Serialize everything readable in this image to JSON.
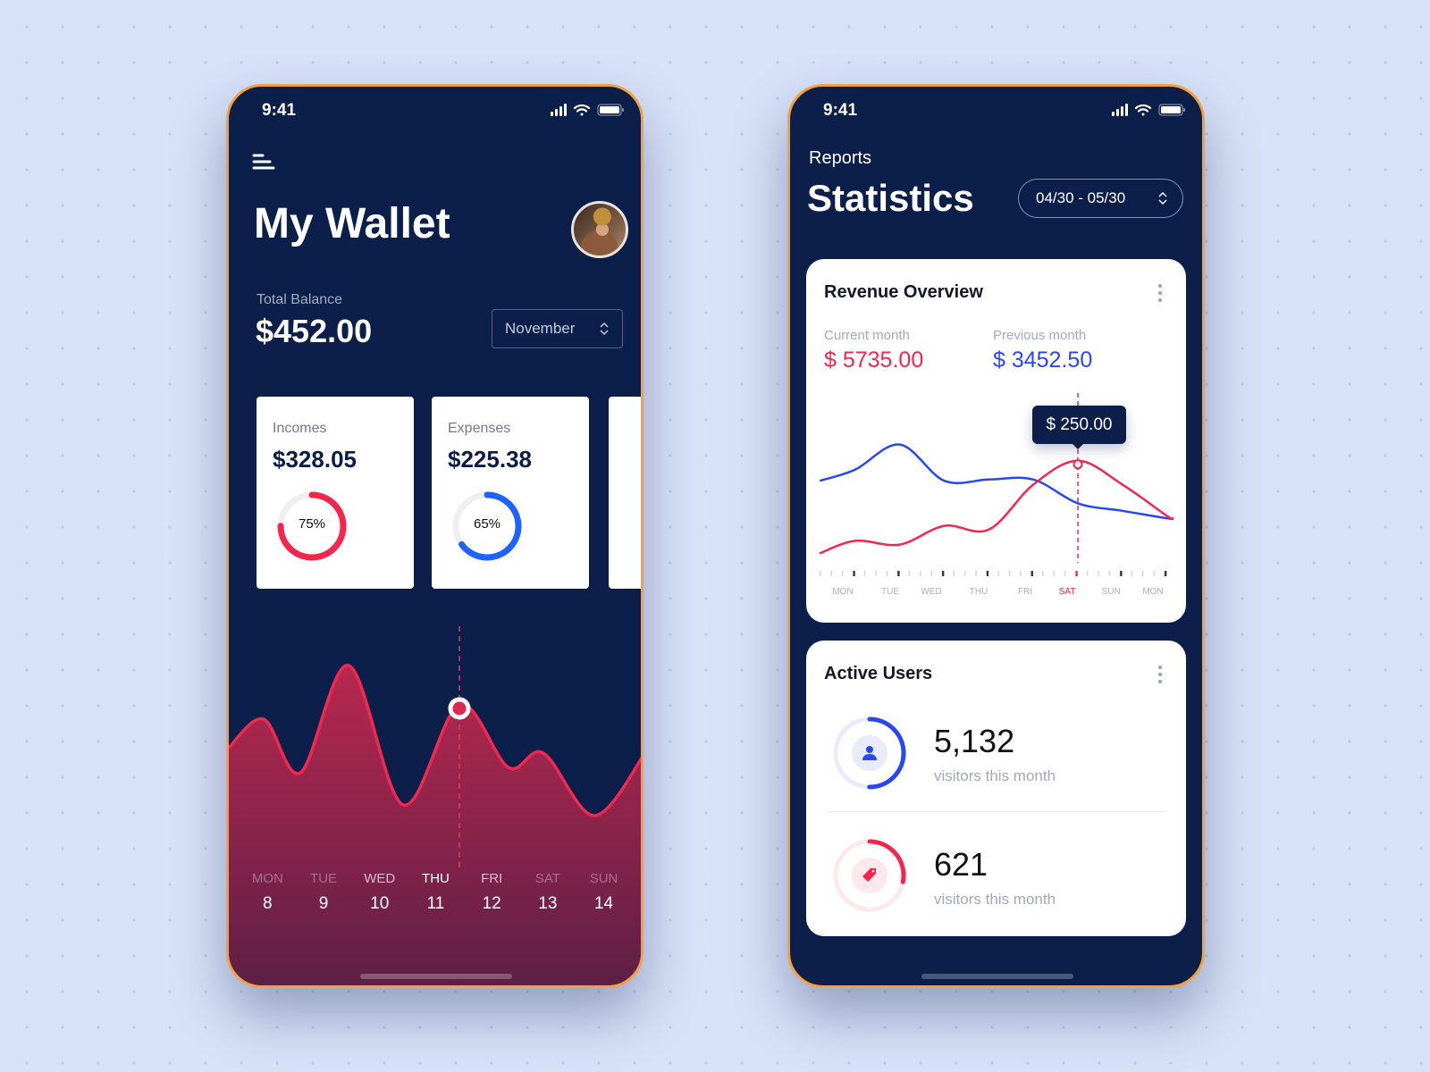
{
  "colors": {
    "navy": "#0b1f4a",
    "red": "#f5264d",
    "blue": "#2747f5",
    "expense_blue": "#1e63ff",
    "frame": "#f5a03c"
  },
  "wallet": {
    "status": {
      "time": "9:41",
      "icons": [
        "signal-icon",
        "wifi-icon",
        "battery-icon"
      ]
    },
    "menu_icon": "menu-icon",
    "title": "My Wallet",
    "avatar": "avatar",
    "balance": {
      "label": "Total Balance",
      "value": "$452.00"
    },
    "month_select": {
      "value": "November"
    },
    "cards": [
      {
        "label": "Incomes",
        "amount": "$328.05",
        "percent": 75,
        "percent_label": "75%",
        "color": "#f5264d"
      },
      {
        "label": "Expenses",
        "amount": "$225.38",
        "percent": 65,
        "percent_label": "65%",
        "color": "#1e63ff"
      }
    ],
    "days": [
      {
        "name": "MON",
        "date": "8"
      },
      {
        "name": "TUE",
        "date": "9"
      },
      {
        "name": "WED",
        "date": "10"
      },
      {
        "name": "THU",
        "date": "11"
      },
      {
        "name": "FRI",
        "date": "12"
      },
      {
        "name": "SAT",
        "date": "13"
      },
      {
        "name": "SUN",
        "date": "14"
      }
    ],
    "selected_day": "11"
  },
  "stats": {
    "status": {
      "time": "9:41"
    },
    "subtitle": "Reports",
    "title": "Statistics",
    "date_range": "04/30 - 05/30",
    "revenue": {
      "title": "Revenue Overview",
      "current_label": "Current month",
      "current_value": "$ 5735.00",
      "previous_label": "Previous month",
      "previous_value": "$ 3452.50",
      "tooltip": "$ 250.00",
      "days": [
        "MON",
        "TUE",
        "WED",
        "THU",
        "FRI",
        "SAT",
        "SUN",
        "MON"
      ],
      "selected_index": 5
    },
    "active_users": {
      "title": "Active Users",
      "rows": [
        {
          "value": "5,132",
          "label": "visitors this month",
          "icon": "user-icon",
          "percent": 50,
          "color": "#2747f5"
        },
        {
          "value": "621",
          "label": "visitors this month",
          "icon": "tag-icon",
          "percent": 28,
          "color": "#f5264d"
        }
      ]
    }
  },
  "chart_data": [
    {
      "type": "area",
      "x": [
        6.85,
        7.48,
        8.14,
        9.01,
        9.99,
        11,
        11.88,
        12.51,
        13.43,
        14.36
      ],
      "values": [
        58,
        74,
        44,
        104,
        26,
        82,
        47,
        55,
        20,
        56
      ],
      "categories": [
        "8",
        "9",
        "10",
        "11",
        "12",
        "13",
        "14"
      ],
      "highlight_x": 11
    },
    {
      "type": "line",
      "categories": [
        "MON",
        "TUE",
        "WED",
        "THU",
        "FRI",
        "SAT",
        "SUN",
        "MON"
      ],
      "x": [
        -0.8,
        0,
        1,
        2,
        3,
        4,
        5,
        6,
        7,
        7.15
      ],
      "series": [
        {
          "color": "#2747f5",
          "values": [
            62,
            71,
            91,
            62,
            63,
            63,
            44,
            38,
            32,
            32
          ]
        },
        {
          "color": "#f5264d",
          "values": [
            4,
            14,
            11,
            26,
            23,
            59,
            78,
            59,
            34,
            32
          ]
        }
      ],
      "highlight": {
        "category": "SAT",
        "value": "$ 250.00"
      }
    }
  ]
}
